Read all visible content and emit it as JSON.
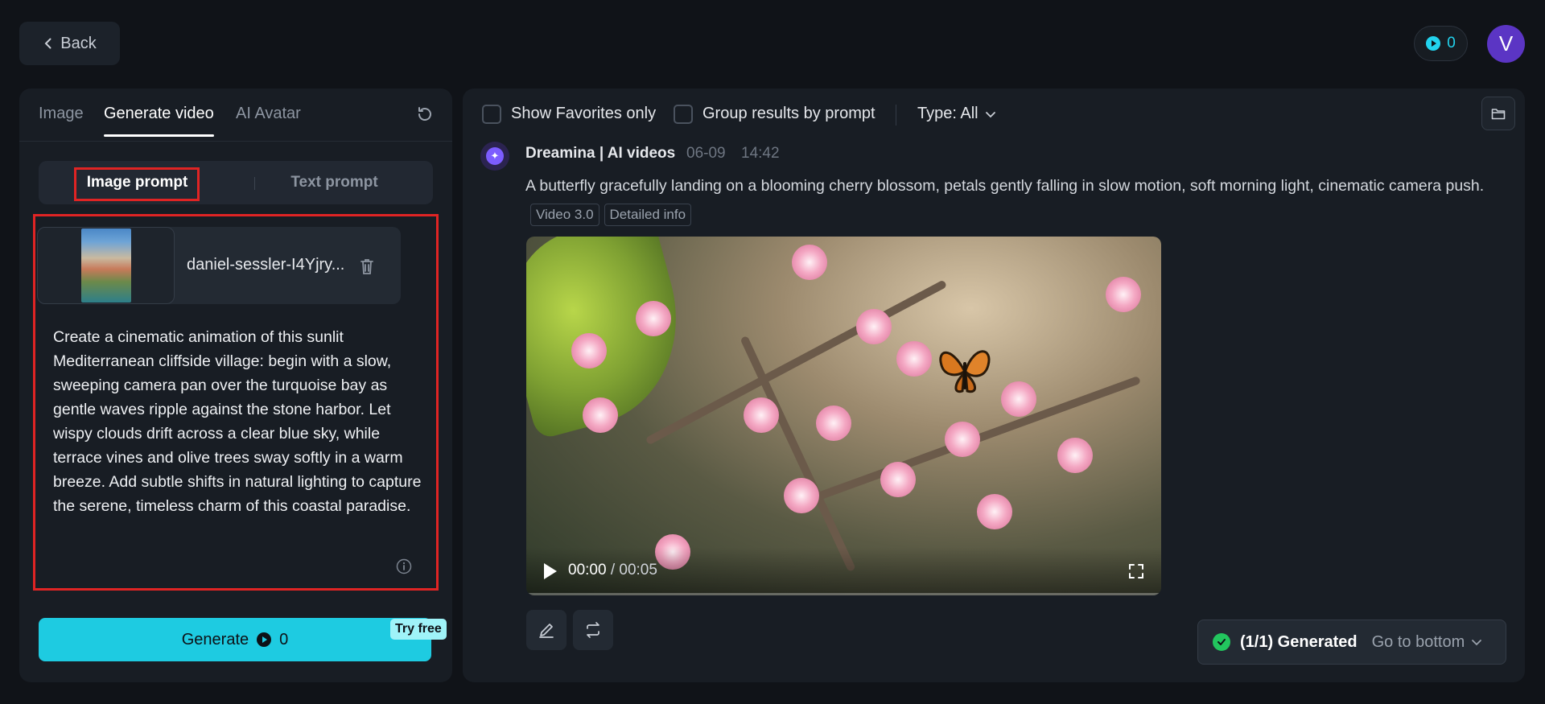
{
  "header": {
    "back_label": "Back",
    "credits": "0",
    "avatar_letter": "V"
  },
  "left_panel": {
    "tabs": [
      {
        "label": "Image"
      },
      {
        "label": "Generate video",
        "active": true
      },
      {
        "label": "AI Avatar"
      }
    ],
    "prompt_modes": [
      "Image prompt",
      "Text prompt"
    ],
    "file_name": "daniel-sessler-I4Yjry...",
    "prompt_text": "Create a cinematic animation of this sunlit Mediterranean cliffside village: begin with a slow, sweeping camera pan over the turquoise bay as gentle waves ripple against the stone harbor. Let wispy clouds drift across a clear blue sky, while terrace vines and olive trees sway softly in a warm breeze. Add subtle shifts in natural lighting to capture the serene, timeless charm of this coastal paradise.",
    "generate_label": "Generate",
    "generate_cost": "0",
    "try_free": "Try free"
  },
  "right_panel": {
    "show_favorites_label": "Show Favorites only",
    "group_by_prompt_label": "Group results by prompt",
    "type_filter": "Type: All",
    "result": {
      "source": "Dreamina | AI videos",
      "date": "06-09",
      "time": "14:42",
      "description": "A butterfly gracefully landing on a blooming cherry blossom, petals gently falling in slow motion, soft morning light, cinematic camera push.",
      "model_tag": "Video 3.0",
      "details_tag": "Detailed info",
      "video_current": "00:00",
      "video_duration": "/ 00:05"
    },
    "status": {
      "generated": "(1/1) Generated",
      "go_to_bottom": "Go to bottom"
    }
  },
  "colors": {
    "background": "#101318",
    "panel": "#181d24",
    "accent": "#1ecbe1",
    "highlight": "#e02424",
    "avatar": "#5b35c4"
  }
}
